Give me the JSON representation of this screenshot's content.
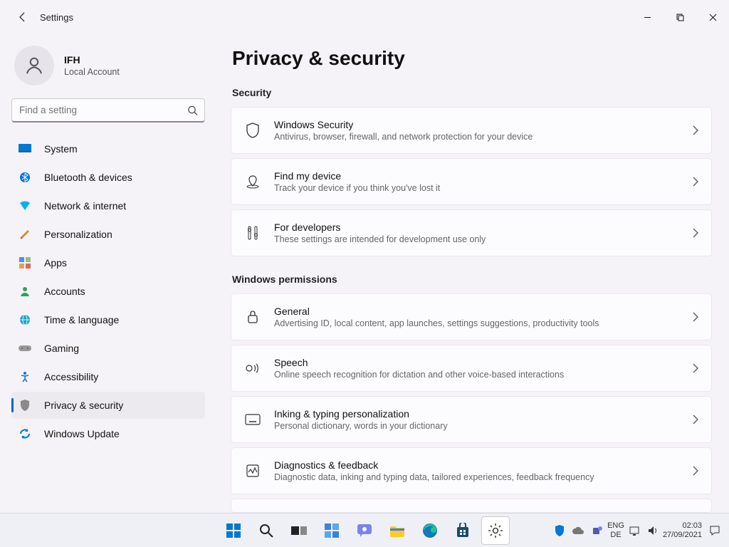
{
  "window": {
    "title": "Settings"
  },
  "account": {
    "name": "IFH",
    "subtitle": "Local Account"
  },
  "search": {
    "placeholder": "Find a setting"
  },
  "sidebar": {
    "items": [
      {
        "label": "System"
      },
      {
        "label": "Bluetooth & devices"
      },
      {
        "label": "Network & internet"
      },
      {
        "label": "Personalization"
      },
      {
        "label": "Apps"
      },
      {
        "label": "Accounts"
      },
      {
        "label": "Time & language"
      },
      {
        "label": "Gaming"
      },
      {
        "label": "Accessibility"
      },
      {
        "label": "Privacy & security"
      },
      {
        "label": "Windows Update"
      }
    ]
  },
  "page": {
    "title": "Privacy & security",
    "sections": {
      "security": {
        "heading": "Security",
        "items": [
          {
            "title": "Windows Security",
            "subtitle": "Antivirus, browser, firewall, and network protection for your device"
          },
          {
            "title": "Find my device",
            "subtitle": "Track your device if you think you've lost it"
          },
          {
            "title": "For developers",
            "subtitle": "These settings are intended for development use only"
          }
        ]
      },
      "permissions": {
        "heading": "Windows permissions",
        "items": [
          {
            "title": "General",
            "subtitle": "Advertising ID, local content, app launches, settings suggestions, productivity tools"
          },
          {
            "title": "Speech",
            "subtitle": "Online speech recognition for dictation and other voice-based interactions"
          },
          {
            "title": "Inking & typing personalization",
            "subtitle": "Personal dictionary, words in your dictionary"
          },
          {
            "title": "Diagnostics & feedback",
            "subtitle": "Diagnostic data, inking and typing data, tailored experiences, feedback frequency"
          }
        ]
      }
    }
  },
  "taskbar": {
    "lang1": "ENG",
    "lang2": "DE",
    "time": "02:03",
    "date": "27/09/2021"
  }
}
